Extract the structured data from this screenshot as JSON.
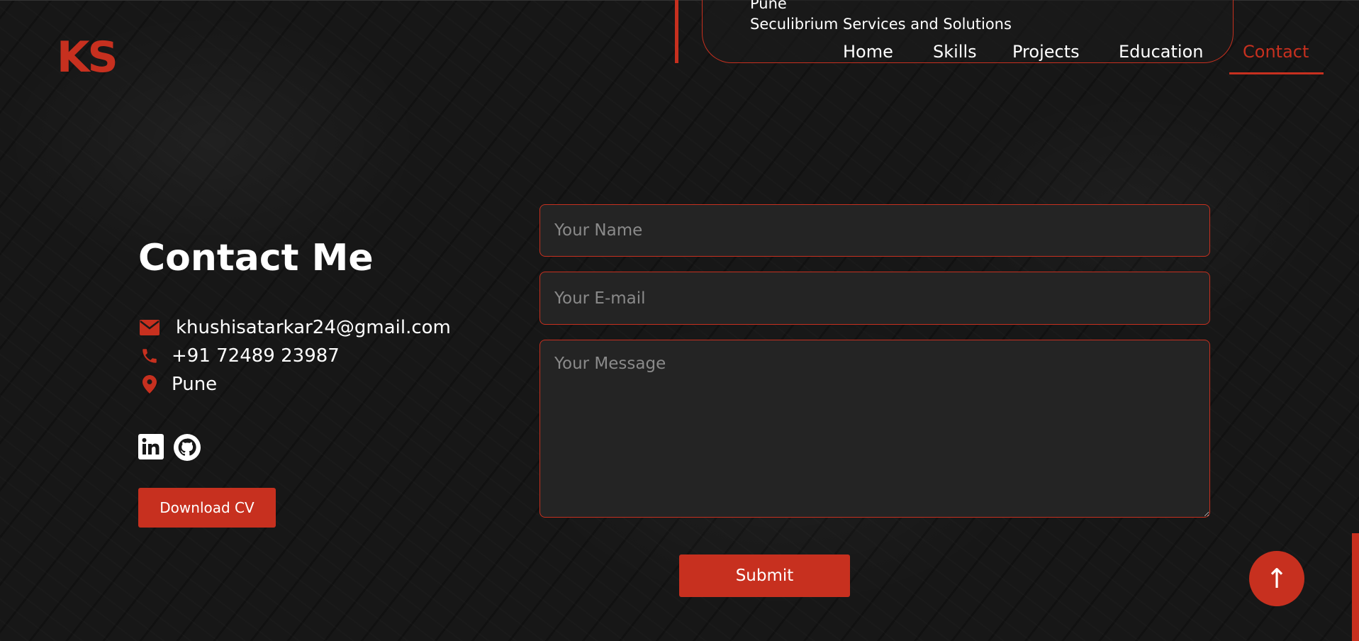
{
  "brand": {
    "logo_text": "KS",
    "accent": "#c7301f"
  },
  "timeline_card": {
    "location": "Pune",
    "company": "Seculibrium Services and Solutions"
  },
  "nav": {
    "items": [
      {
        "label": "Home"
      },
      {
        "label": "Skills"
      },
      {
        "label": "Projects"
      },
      {
        "label": "Education"
      },
      {
        "label": "Contact",
        "active": true
      }
    ]
  },
  "contact": {
    "title": "Contact Me",
    "email": "khushisatarkar24@gmail.com",
    "phone": "+91 72489 23987",
    "location": "Pune",
    "icons": {
      "email": "envelope-icon",
      "phone": "phone-icon",
      "location": "map-pin-icon"
    },
    "social": [
      {
        "icon": "linkedin-icon"
      },
      {
        "icon": "github-icon"
      }
    ],
    "cv_button": "Download CV"
  },
  "form": {
    "name_placeholder": "Your Name",
    "email_placeholder": "Your E-mail",
    "message_placeholder": "Your Message",
    "submit_label": "Submit"
  },
  "scroll_top": {
    "label": "↑",
    "icon": "arrow-up-icon"
  }
}
